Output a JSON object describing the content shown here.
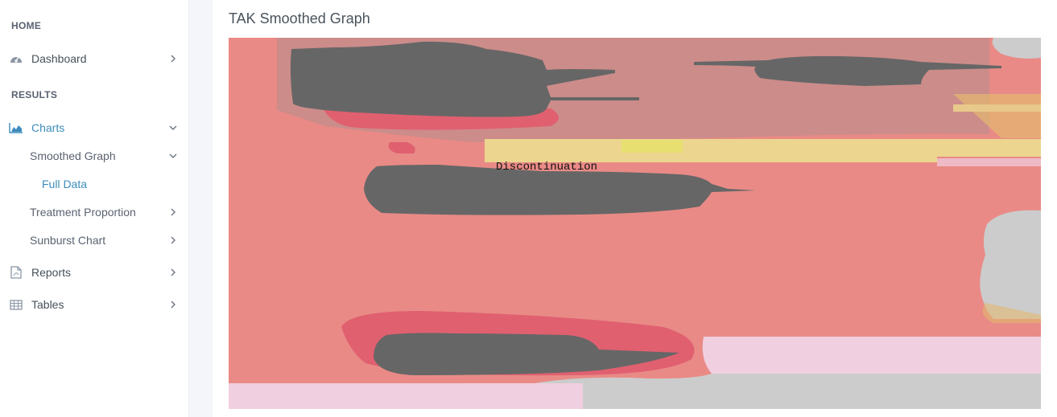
{
  "sidebar": {
    "sections": [
      {
        "label": "HOME"
      },
      {
        "label": "RESULTS"
      }
    ],
    "items": [
      {
        "label": "Dashboard",
        "icon": "dashboard-gauge-icon"
      },
      {
        "label": "Charts",
        "icon": "area-chart-icon"
      },
      {
        "label": "Reports",
        "icon": "pdf-file-icon"
      },
      {
        "label": "Tables",
        "icon": "table-icon"
      }
    ],
    "charts_children": [
      {
        "label": "Smoothed Graph"
      },
      {
        "label": "Treatment Proportion"
      },
      {
        "label": "Sunburst Chart"
      }
    ],
    "smoothed_children": [
      {
        "label": "Full Data"
      }
    ]
  },
  "main": {
    "title": "TAK Smoothed Graph"
  },
  "chart_data": {
    "type": "area",
    "title": "",
    "annotations": [
      "Discontinuation"
    ],
    "colors": {
      "discontinuation": "#666666",
      "band_salmon": "#e98a86",
      "band_mauve": "#cc8c8a",
      "band_pink_light": "#f0cfe0",
      "band_gray": "#cccccc",
      "band_yellow": "#ecd58f",
      "band_red": "#e06070"
    }
  }
}
